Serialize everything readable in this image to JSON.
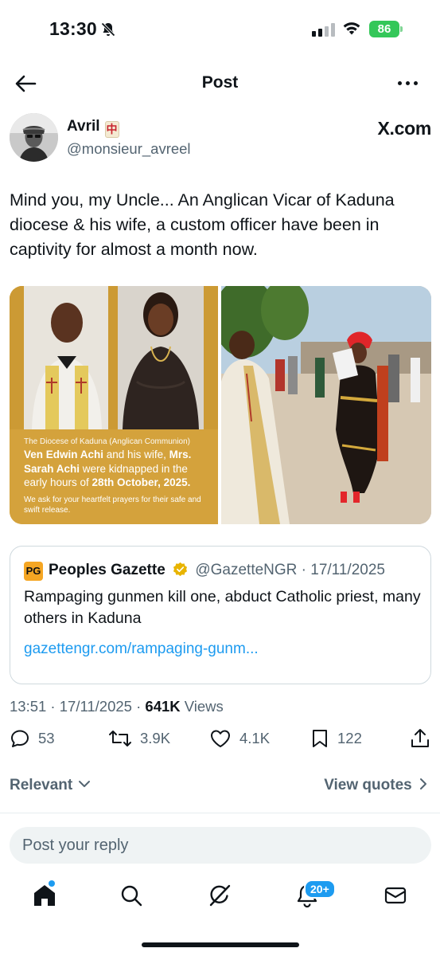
{
  "status_bar": {
    "time": "13:30",
    "battery": "86"
  },
  "nav": {
    "title": "Post"
  },
  "post": {
    "author_name": "Avril",
    "author_emoji": "中",
    "author_handle": "@monsieur_avreel",
    "source_brand": "X.com",
    "text": "Mind you, my Uncle... An Anglican Vicar of Kaduna diocese & his wife, a custom officer have been in captivity for almost a month now.",
    "poster": {
      "line1": "The Diocese of Kaduna (Anglican Communion)",
      "name1": "Ven Edwin Achi",
      "mid": " and his wife,",
      "name2": "Mrs. Sarah Achi",
      "mid2": " were kidnapped in the early hours of ",
      "date": "28th October, 2025.",
      "prayer": "We ask for your heartfelt prayers for their safe and swift release."
    },
    "quote": {
      "name": "Peoples Gazette",
      "logo_text": "PG",
      "meta": "@GazetteNGR · 17/11/2025",
      "text": "Rampaging gunmen kill one, abduct Catholic priest, many others in Kaduna",
      "link": "gazettengr.com/rampaging-gunm..."
    },
    "timestamp": "13:51 · 17/11/2025 · ",
    "views_count": "641K",
    "views_label": " Views",
    "stats": {
      "replies": "53",
      "reposts": "3.9K",
      "likes": "4.1K",
      "bookmarks": "122"
    }
  },
  "sort": {
    "label": "Relevant",
    "view_quotes": "View quotes"
  },
  "reply": {
    "placeholder": "Post your reply"
  },
  "tabbar": {
    "notification_badge": "20+"
  },
  "colors": {
    "accent": "#1d9bf0",
    "secondary_text": "#536471",
    "battery": "#34c759",
    "gazette_logo": "#f5a623",
    "verified": "#e8b400"
  }
}
